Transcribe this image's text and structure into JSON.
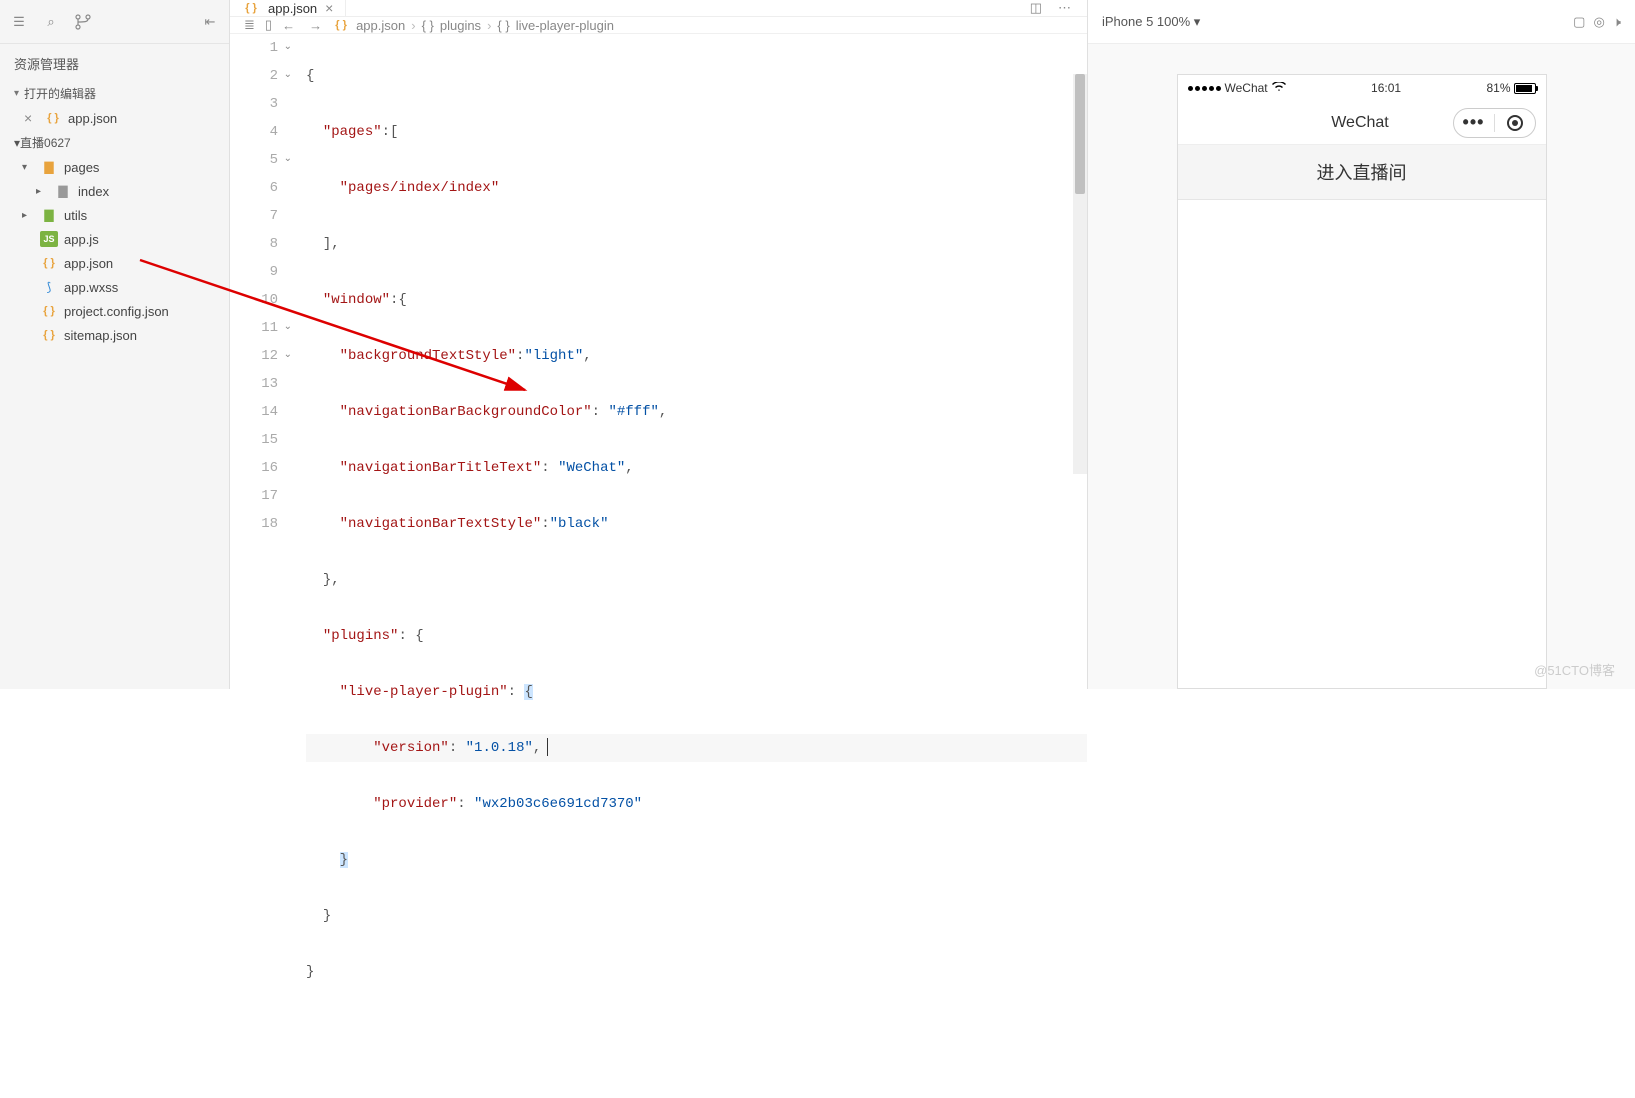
{
  "sidebar": {
    "title": "资源管理器",
    "open_editors_label": "打开的编辑器",
    "open_file": "app.json",
    "project_name": "直播0627",
    "tree": {
      "pages": "pages",
      "index": "index",
      "utils": "utils",
      "appjs": "app.js",
      "appjson": "app.json",
      "appwxss": "app.wxss",
      "projconfig": "project.config.json",
      "sitemap": "sitemap.json"
    }
  },
  "editor": {
    "tab_label": "app.json",
    "breadcrumb": {
      "file": "app.json",
      "seg1": "plugins",
      "seg2": "live-player-plugin"
    },
    "code": {
      "l1": "{",
      "l2_key": "\"pages\"",
      "l2_rest": ":[",
      "l3": "\"pages/index/index\"",
      "l4": "],",
      "l5_key": "\"window\"",
      "l5_rest": ":{",
      "l6_key": "\"backgroundTextStyle\"",
      "l6_val": "\"light\"",
      "l7_key": "\"navigationBarBackgroundColor\"",
      "l7_val": "\"#fff\"",
      "l8_key": "\"navigationBarTitleText\"",
      "l8_val": "\"WeChat\"",
      "l9_key": "\"navigationBarTextStyle\"",
      "l9_val": "\"black\"",
      "l10": "},",
      "l11_key": "\"plugins\"",
      "l11_rest": ": {",
      "l12_key": "\"live-player-plugin\"",
      "l12_rest": ": {",
      "l13_key": "\"version\"",
      "l13_val": "\"1.0.18\"",
      "l14_key": "\"provider\"",
      "l14_val": "\"wx2b03c6e691cd7370\"",
      "l15": "}",
      "l16": "}",
      "l17": "}"
    }
  },
  "simulator": {
    "device_label": "iPhone 5 100%",
    "status": {
      "carrier": "WeChat",
      "time": "16:01",
      "battery": "81%"
    },
    "nav_title": "WeChat",
    "button_text": "进入直播间"
  },
  "watermark": "@51CTO博客"
}
